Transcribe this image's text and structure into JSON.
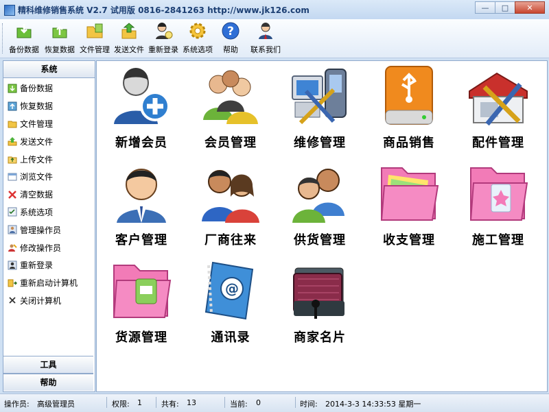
{
  "window": {
    "title": "精科维修销售系统 V2.7 试用版 0816-2841263 http://www.jk126.com",
    "controls": [
      "—",
      "□",
      "✕"
    ]
  },
  "toolbar": {
    "items": [
      {
        "label": "备份数据",
        "icon": "backup-icon"
      },
      {
        "label": "恢复数据",
        "icon": "restore-icon"
      },
      {
        "label": "文件管理",
        "icon": "folder-icon"
      },
      {
        "label": "发送文件",
        "icon": "send-file-icon"
      },
      {
        "label": "重新登录",
        "icon": "relogin-icon"
      },
      {
        "label": "系统选项",
        "icon": "gear-icon"
      },
      {
        "label": "帮助",
        "icon": "help-icon"
      },
      {
        "label": "联系我们",
        "icon": "contact-icon"
      }
    ]
  },
  "sidebar": {
    "header": "系统",
    "items": [
      {
        "label": "备份数据",
        "icon": "backup-icon"
      },
      {
        "label": "恢复数据",
        "icon": "restore-icon"
      },
      {
        "label": "文件管理",
        "icon": "folder-icon"
      },
      {
        "label": "发送文件",
        "icon": "send-file-icon"
      },
      {
        "label": "上传文件",
        "icon": "upload-icon"
      },
      {
        "label": "浏览文件",
        "icon": "browse-icon"
      },
      {
        "label": "清空数据",
        "icon": "clear-icon"
      },
      {
        "label": "系统选项",
        "icon": "options-icon"
      },
      {
        "label": "管理操作员",
        "icon": "operator-icon"
      },
      {
        "label": "修改操作员",
        "icon": "edit-operator-icon"
      },
      {
        "label": "重新登录",
        "icon": "relogin-icon"
      },
      {
        "label": "重新启动计算机",
        "icon": "restart-icon"
      },
      {
        "label": "关闭计算机",
        "icon": "shutdown-icon"
      }
    ],
    "footer": [
      "工具",
      "帮助"
    ]
  },
  "main": {
    "tiles": [
      {
        "label": "新增会员",
        "icon": "add-member-icon"
      },
      {
        "label": "会员管理",
        "icon": "members-icon"
      },
      {
        "label": "维修管理",
        "icon": "repair-icon"
      },
      {
        "label": "商品销售",
        "icon": "usb-drive-icon"
      },
      {
        "label": "配件管理",
        "icon": "parts-icon"
      },
      {
        "label": "客户管理",
        "icon": "customer-icon"
      },
      {
        "label": "厂商往来",
        "icon": "vendor-icon"
      },
      {
        "label": "供货管理",
        "icon": "supply-icon"
      },
      {
        "label": "收支管理",
        "icon": "pink-folder-icon"
      },
      {
        "label": "施工管理",
        "icon": "construction-folder-icon"
      },
      {
        "label": "货源管理",
        "icon": "source-folder-icon"
      },
      {
        "label": "通讯录",
        "icon": "address-book-icon"
      },
      {
        "label": "商家名片",
        "icon": "card-holder-icon"
      }
    ]
  },
  "status": {
    "operator_label": "操作员:",
    "operator": "高级管理员",
    "rights_label": "权限:",
    "rights": "1",
    "total_label": "共有:",
    "total": "13",
    "current_label": "当前:",
    "current": "0",
    "time_label": "时间:",
    "time": "2014-3-3 14:33:53 星期一"
  },
  "colors": {
    "frame": "#cfe0f3",
    "accent": "#1c3f73",
    "close": "#c8462f"
  }
}
